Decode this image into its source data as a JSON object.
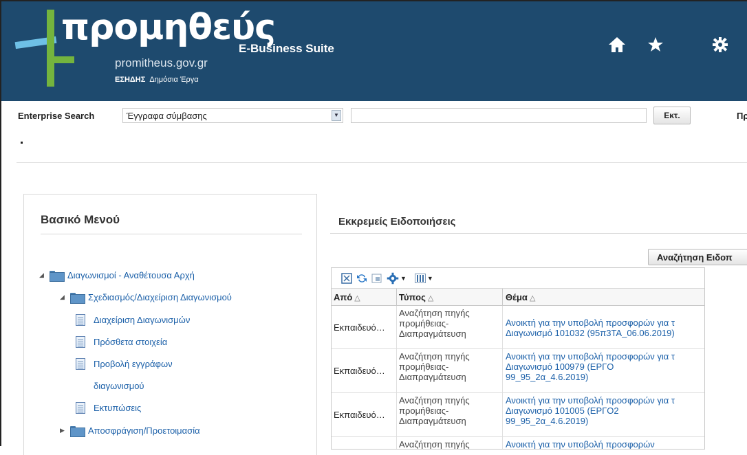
{
  "header": {
    "logo_word": "προμηθεύς",
    "logo_domain": "promitheus.gov.gr",
    "logo_org": "ΕΣΗΔΗΣ",
    "logo_org_sub": "Δημόσια Έργα",
    "suite_name": "E-Business Suite",
    "icons": [
      "home-icon",
      "favorites-star-icon",
      "settings-gear-icon"
    ]
  },
  "search": {
    "label": "Enterprise Search",
    "selected_option": "Έγγραφα σύμβασης",
    "input_value": "",
    "go_button": "Εκτ.",
    "cut_off_text": "Πρ"
  },
  "left_menu": {
    "title": "Βασικό Μενού",
    "items": [
      {
        "label": "Διαγωνισμοί - Αναθέτουσα Αρχή",
        "type": "folder",
        "state": "expanded"
      },
      {
        "label": "Σχεδιασμός/Διαχείριση Διαγωνισμού",
        "type": "folder",
        "state": "expanded"
      },
      {
        "label": "Διαχείριση Διαγωνισμών",
        "type": "page"
      },
      {
        "label": "Πρόσθετα στοιχεία",
        "type": "page"
      },
      {
        "label": "Προβολή εγγράφων",
        "label_line2": "διαγωνισμού",
        "type": "page"
      },
      {
        "label": "Εκτυπώσεις",
        "type": "page"
      },
      {
        "label": "Αποσφράγιση/Προετοιμασία",
        "type": "folder",
        "state": "collapsed"
      }
    ]
  },
  "notifications": {
    "title": "Εκκρεμείς Ειδοποιήσεις",
    "search_button": "Αναζήτηση Ειδοπ",
    "toolbar_icons": [
      "detach-icon",
      "refresh-icon",
      "freeze-icon",
      "actions-gear-icon",
      "columns-icon"
    ],
    "columns": [
      "Από",
      "Τύπος",
      "Θέμα"
    ],
    "rows": [
      {
        "from": "Εκπαιδευό…",
        "type": [
          "Αναζήτηση πηγής",
          "προμήθειας-",
          "Διαπραγμάτευση"
        ],
        "subject": [
          "Ανοικτή για την υποβολή προσφορών για τ",
          "Διαγωνισμό 101032 (95π3ΤΑ_06.06.2019)"
        ]
      },
      {
        "from": "Εκπαιδευό…",
        "type": [
          "Αναζήτηση πηγής",
          "προμήθειας-",
          "Διαπραγμάτευση"
        ],
        "subject": [
          "Ανοικτή για την υποβολή προσφορών για τ",
          "Διαγωνισμό 100979 (ΕΡΓΟ",
          "99_95_2α_4.6.2019)"
        ]
      },
      {
        "from": "Εκπαιδευό…",
        "type": [
          "Αναζήτηση πηγής",
          "προμήθειας-",
          "Διαπραγμάτευση"
        ],
        "subject": [
          "Ανοικτή για την υποβολή προσφορών για τ",
          "Διαγωνισμό 101005 (ΕΡΓΟ2",
          "99_95_2α_4.6.2019)"
        ]
      },
      {
        "from": "",
        "type": [
          "Αναζήτηση πηγής"
        ],
        "subject": [
          "Ανοικτή για την υποβολή προσφορών"
        ]
      }
    ]
  },
  "colors": {
    "header_bg": "#1e4a6e",
    "link": "#1a5fa8",
    "logo_green": "#74b43e",
    "logo_blue": "#6ec0e6"
  }
}
